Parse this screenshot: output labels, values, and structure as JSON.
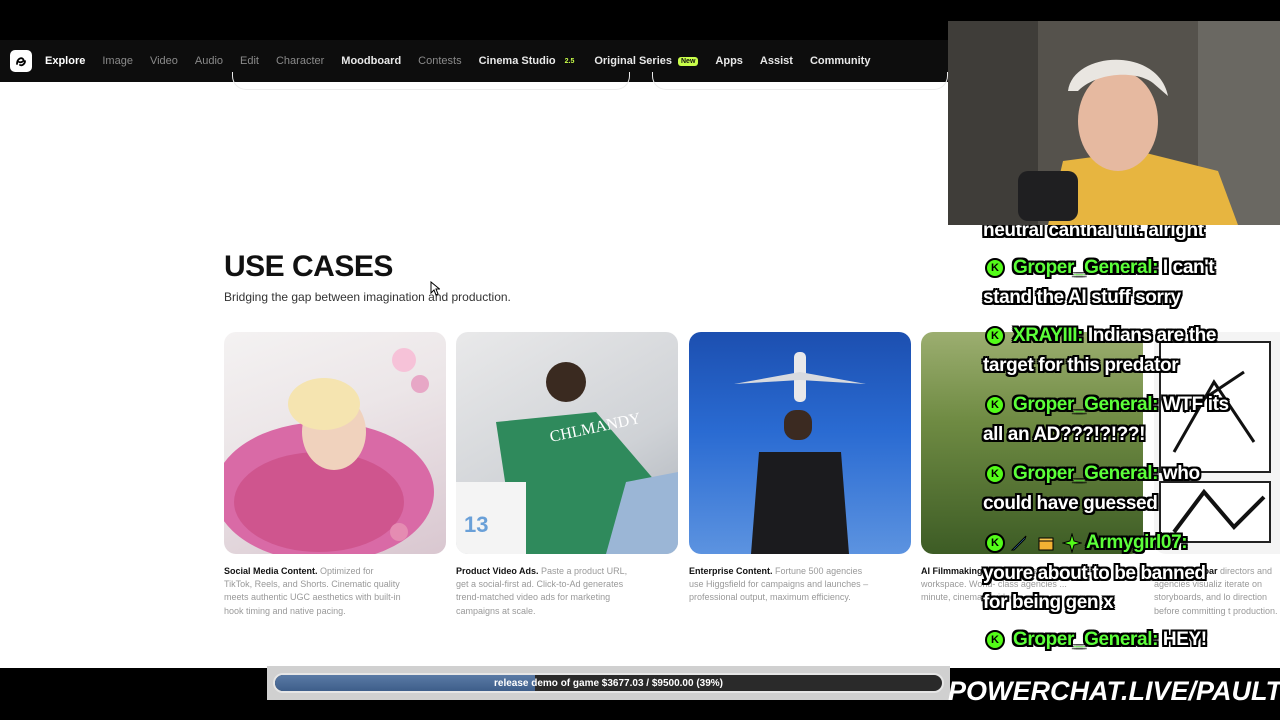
{
  "nav": {
    "items": [
      {
        "label": "Explore",
        "style": "active"
      },
      {
        "label": "Image",
        "style": "muted"
      },
      {
        "label": "Video",
        "style": "muted"
      },
      {
        "label": "Audio",
        "style": "muted"
      },
      {
        "label": "Edit",
        "style": "muted"
      },
      {
        "label": "Character",
        "style": "muted"
      },
      {
        "label": "Moodboard",
        "style": "bold"
      },
      {
        "label": "Contests",
        "style": "muted"
      },
      {
        "label": "Cinema Studio",
        "style": "bold",
        "badge": "2.5",
        "badge_type": "ver"
      },
      {
        "label": "Original Series",
        "style": "bold",
        "badge": "New",
        "badge_type": "new"
      },
      {
        "label": "Apps",
        "style": "bold"
      },
      {
        "label": "Assist",
        "style": "bold"
      },
      {
        "label": "Community",
        "style": "bold"
      }
    ]
  },
  "use_cases": {
    "title": "USE CASES",
    "subtitle": "Bridging the gap between imagination and production.",
    "cards": [
      {
        "heading": "Social Media Content.",
        "body": "Optimized for TikTok, Reels, and Shorts. Cinematic quality meets authentic UGC aesthetics with built-in hook timing and native pacing."
      },
      {
        "heading": "Product Video Ads.",
        "body": "Paste a product URL, get a social-first ad. Click-to-Ad generates trend-matched video ads for marketing campaigns at scale."
      },
      {
        "heading": "Enterprise Content.",
        "body": "Fortune 500 agencies use Higgsfield for campaigns and launches – professional output, maximum efficiency."
      },
      {
        "heading": "AI Filmmaking",
        "body": "flagship horizo... al workspace. World- class agencies ... minute, cinematic videos."
      },
      {
        "heading": "...nd Storyboar",
        "body": "directors and agencies visualiz iterate on storyboards, and lo direction before committing t production."
      }
    ]
  },
  "chat": {
    "top_fragment": "neutral canthal tilt. alright",
    "messages": [
      {
        "user": "Groper_General:",
        "text": "I can't",
        "cont": "stand the AI stuff sorry"
      },
      {
        "user": "XRAYIII:",
        "text": "Indians are the",
        "cont": "target for this predator"
      },
      {
        "user": "Groper_General:",
        "text": "WTF its",
        "cont": "all an AD???!?!??!"
      },
      {
        "user": "Groper_General:",
        "text": "who",
        "cont": "could have guessed"
      },
      {
        "user": "Armygirl07:",
        "text": "",
        "cont": "youre about to be banned",
        "cont2": "for being gen x"
      },
      {
        "user": "Groper_General:",
        "text": "HEY!",
        "cont": ""
      }
    ]
  },
  "progress": {
    "label": "release demo of game $3677.03 / $9500.00 (39%)",
    "fraction": 0.39
  },
  "brand": "POWERCHAT.LIVE/PAULTOWN",
  "colors": {
    "accent": "#c9ff4a",
    "chat_user": "#5cff3a",
    "kick": "#53fc18"
  }
}
